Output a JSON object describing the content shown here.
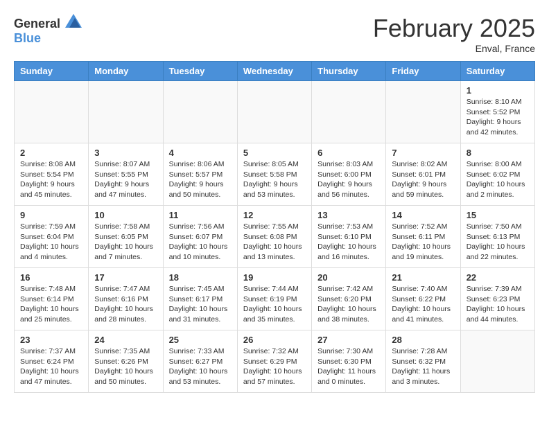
{
  "header": {
    "logo_general": "General",
    "logo_blue": "Blue",
    "month_title": "February 2025",
    "location": "Enval, France"
  },
  "weekdays": [
    "Sunday",
    "Monday",
    "Tuesday",
    "Wednesday",
    "Thursday",
    "Friday",
    "Saturday"
  ],
  "weeks": [
    [
      {
        "day": "",
        "info": ""
      },
      {
        "day": "",
        "info": ""
      },
      {
        "day": "",
        "info": ""
      },
      {
        "day": "",
        "info": ""
      },
      {
        "day": "",
        "info": ""
      },
      {
        "day": "",
        "info": ""
      },
      {
        "day": "1",
        "info": "Sunrise: 8:10 AM\nSunset: 5:52 PM\nDaylight: 9 hours and 42 minutes."
      }
    ],
    [
      {
        "day": "2",
        "info": "Sunrise: 8:08 AM\nSunset: 5:54 PM\nDaylight: 9 hours and 45 minutes."
      },
      {
        "day": "3",
        "info": "Sunrise: 8:07 AM\nSunset: 5:55 PM\nDaylight: 9 hours and 47 minutes."
      },
      {
        "day": "4",
        "info": "Sunrise: 8:06 AM\nSunset: 5:57 PM\nDaylight: 9 hours and 50 minutes."
      },
      {
        "day": "5",
        "info": "Sunrise: 8:05 AM\nSunset: 5:58 PM\nDaylight: 9 hours and 53 minutes."
      },
      {
        "day": "6",
        "info": "Sunrise: 8:03 AM\nSunset: 6:00 PM\nDaylight: 9 hours and 56 minutes."
      },
      {
        "day": "7",
        "info": "Sunrise: 8:02 AM\nSunset: 6:01 PM\nDaylight: 9 hours and 59 minutes."
      },
      {
        "day": "8",
        "info": "Sunrise: 8:00 AM\nSunset: 6:02 PM\nDaylight: 10 hours and 2 minutes."
      }
    ],
    [
      {
        "day": "9",
        "info": "Sunrise: 7:59 AM\nSunset: 6:04 PM\nDaylight: 10 hours and 4 minutes."
      },
      {
        "day": "10",
        "info": "Sunrise: 7:58 AM\nSunset: 6:05 PM\nDaylight: 10 hours and 7 minutes."
      },
      {
        "day": "11",
        "info": "Sunrise: 7:56 AM\nSunset: 6:07 PM\nDaylight: 10 hours and 10 minutes."
      },
      {
        "day": "12",
        "info": "Sunrise: 7:55 AM\nSunset: 6:08 PM\nDaylight: 10 hours and 13 minutes."
      },
      {
        "day": "13",
        "info": "Sunrise: 7:53 AM\nSunset: 6:10 PM\nDaylight: 10 hours and 16 minutes."
      },
      {
        "day": "14",
        "info": "Sunrise: 7:52 AM\nSunset: 6:11 PM\nDaylight: 10 hours and 19 minutes."
      },
      {
        "day": "15",
        "info": "Sunrise: 7:50 AM\nSunset: 6:13 PM\nDaylight: 10 hours and 22 minutes."
      }
    ],
    [
      {
        "day": "16",
        "info": "Sunrise: 7:48 AM\nSunset: 6:14 PM\nDaylight: 10 hours and 25 minutes."
      },
      {
        "day": "17",
        "info": "Sunrise: 7:47 AM\nSunset: 6:16 PM\nDaylight: 10 hours and 28 minutes."
      },
      {
        "day": "18",
        "info": "Sunrise: 7:45 AM\nSunset: 6:17 PM\nDaylight: 10 hours and 31 minutes."
      },
      {
        "day": "19",
        "info": "Sunrise: 7:44 AM\nSunset: 6:19 PM\nDaylight: 10 hours and 35 minutes."
      },
      {
        "day": "20",
        "info": "Sunrise: 7:42 AM\nSunset: 6:20 PM\nDaylight: 10 hours and 38 minutes."
      },
      {
        "day": "21",
        "info": "Sunrise: 7:40 AM\nSunset: 6:22 PM\nDaylight: 10 hours and 41 minutes."
      },
      {
        "day": "22",
        "info": "Sunrise: 7:39 AM\nSunset: 6:23 PM\nDaylight: 10 hours and 44 minutes."
      }
    ],
    [
      {
        "day": "23",
        "info": "Sunrise: 7:37 AM\nSunset: 6:24 PM\nDaylight: 10 hours and 47 minutes."
      },
      {
        "day": "24",
        "info": "Sunrise: 7:35 AM\nSunset: 6:26 PM\nDaylight: 10 hours and 50 minutes."
      },
      {
        "day": "25",
        "info": "Sunrise: 7:33 AM\nSunset: 6:27 PM\nDaylight: 10 hours and 53 minutes."
      },
      {
        "day": "26",
        "info": "Sunrise: 7:32 AM\nSunset: 6:29 PM\nDaylight: 10 hours and 57 minutes."
      },
      {
        "day": "27",
        "info": "Sunrise: 7:30 AM\nSunset: 6:30 PM\nDaylight: 11 hours and 0 minutes."
      },
      {
        "day": "28",
        "info": "Sunrise: 7:28 AM\nSunset: 6:32 PM\nDaylight: 11 hours and 3 minutes."
      },
      {
        "day": "",
        "info": ""
      }
    ]
  ]
}
